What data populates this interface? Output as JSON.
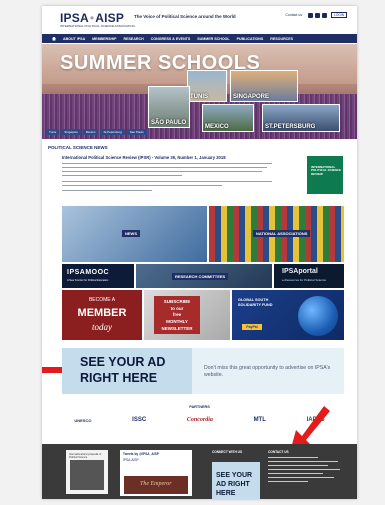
{
  "header": {
    "logo_left": "IPSA",
    "logo_sep": "•",
    "logo_right": "AISP",
    "logo_sub": "INTERNATIONAL POLITICAL SCIENCE ASSOCIATION",
    "tagline": "The Voice of Political Science around the World",
    "right_link": "Contact us",
    "right_button": "LOGIN"
  },
  "nav": {
    "items": [
      "ABOUT IPSA",
      "MEMBERSHIP",
      "RESEARCH",
      "CONGRESS & EVENTS",
      "SUMMER SCHOOL",
      "PUBLICATIONS",
      "RESOURCES"
    ]
  },
  "hero": {
    "title": "SUMMER SCHOOLS",
    "cities": [
      "TUNIS",
      "SINGAPORE",
      "SÃO PAULO",
      "MEXICO",
      "ST.PETERSBURG"
    ],
    "crumbs": [
      "Tunis",
      "Singapore",
      "Mexico",
      "St.Petersburg",
      "Sao Paulo"
    ]
  },
  "psn": {
    "title": "POLITICAL SCIENCE NEWS",
    "headline": "International Political Science Review (IPSR) - Volume 39, Number 1, January 2018",
    "thumb_text": "INTERNATIONAL POLITICAL SCIENCE REVIEW"
  },
  "tiles": {
    "news": "NEWS",
    "national": "NATIONAL ASSOCIATIONS",
    "mooc": "IPSAMOOC",
    "mooc_sub": "A New Frontier for Political Education",
    "rc": "RESEARCH COMMITTEES",
    "portal": "IPSAportal",
    "portal_sub": "e-Resources for Political Science",
    "member_l1": "BECOME A",
    "member_l2": "MEMBER",
    "member_l3": "today",
    "newsletter": [
      "SUBSCRIBE",
      "to our",
      "free",
      "MONTHLY",
      "NEWSLETTER"
    ],
    "global": [
      "GLOBAL SOUTH",
      "SOLIDARITY FUND"
    ],
    "paypal": "PayPal"
  },
  "ad": {
    "line1": "SEE YOUR AD",
    "line2": "RIGHT HERE",
    "small": "Don't miss this great opportunity to advertise on IPSA's website."
  },
  "partners": {
    "title": "PARTNERS",
    "items": [
      "UNESCO",
      "ISSC",
      "Concordia",
      "MTL",
      "IAPSS"
    ]
  },
  "footer": {
    "col1_title": "International Encyclopedia of Political Science",
    "tweets_title": "Tweets by @IPSA_AISP",
    "tweet_name": "IPSA-AISP",
    "book_title": "The Emperor",
    "connect_title": "CONNECT WITH US",
    "ad_line1": "SEE YOUR",
    "ad_line2": "AD RIGHT",
    "ad_line3": "HERE",
    "contact_title": "CONTACT US"
  },
  "colors": {
    "navy": "#1f2f66",
    "arrow": "#e31b1b",
    "ad_bg": "#c5dced"
  }
}
